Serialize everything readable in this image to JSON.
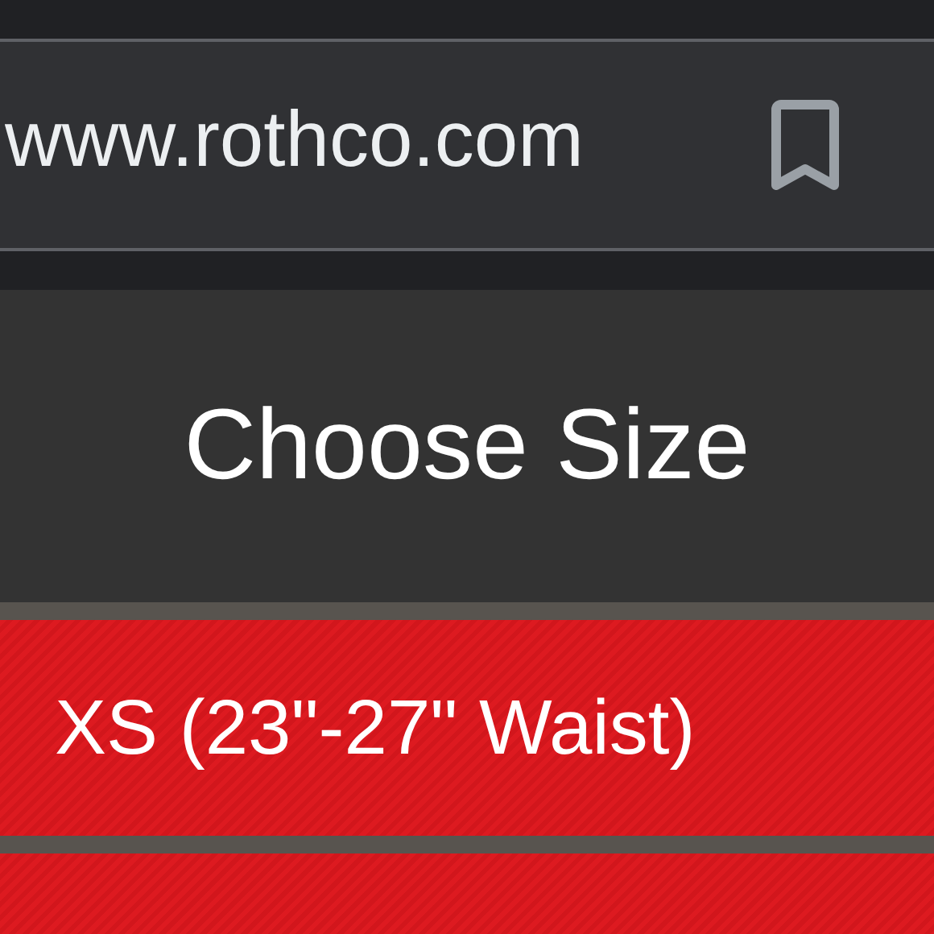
{
  "address_bar": {
    "url": "www.rothco.com"
  },
  "panel": {
    "title": "Choose Size"
  },
  "size_options": [
    {
      "kind": "full",
      "label": "XS (23\"-27\" Waist)"
    },
    {
      "kind": "cut-off"
    }
  ]
}
